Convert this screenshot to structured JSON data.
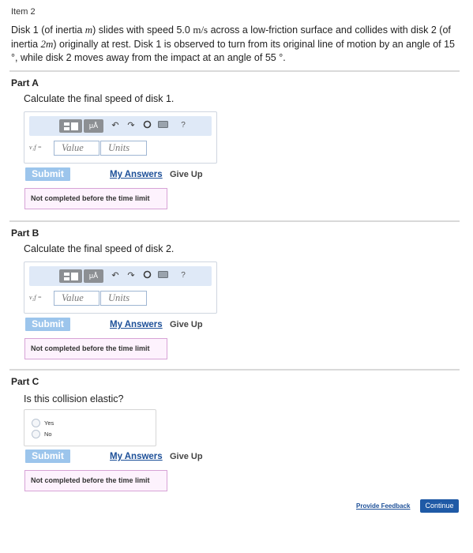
{
  "item": {
    "title": "Item 2"
  },
  "question": {
    "part1": "Disk 1 (of inertia ",
    "m1": "m",
    "part2": ") slides with speed 5.0 ",
    "unit": "m/s",
    "part3": " across a low-friction surface and collides with disk 2 (of inertia ",
    "m2": "2m",
    "part4": ") originally at rest. Disk 1 is observed to turn from its original line of motion by an angle of 15 °, while disk 2 moves away from the impact at an angle of 55 °."
  },
  "toolbar": {
    "template_icon": "template-icon",
    "units_label": "μÅ",
    "undo_icon": "undo-icon",
    "redo_icon": "redo-icon",
    "reset_icon": "reset-icon",
    "keyboard_icon": "keyboard-icon",
    "help_label": "?"
  },
  "input": {
    "value_placeholder": "Value",
    "units_placeholder": "Units"
  },
  "actions": {
    "submit_label": "Submit",
    "my_answers_label": "My Answers",
    "give_up_label": "Give Up"
  },
  "status": {
    "not_completed": "Not completed before the time limit"
  },
  "parts": [
    {
      "label": "Part A",
      "question": "Calculate the final speed of disk 1.",
      "var": "v₁f ="
    },
    {
      "label": "Part B",
      "question": "Calculate the final speed of disk 2.",
      "var": "v₂f ="
    },
    {
      "label": "Part C",
      "question": "Is this collision elastic?",
      "options": [
        "Yes",
        "No"
      ]
    }
  ],
  "footer": {
    "feedback_label": "Provide Feedback",
    "continue_label": "Continue"
  },
  "colors": {
    "submit": "#9cc5ec",
    "link": "#1c4f98",
    "continue": "#1f5aa6",
    "status_border": "#d7a3d6"
  }
}
